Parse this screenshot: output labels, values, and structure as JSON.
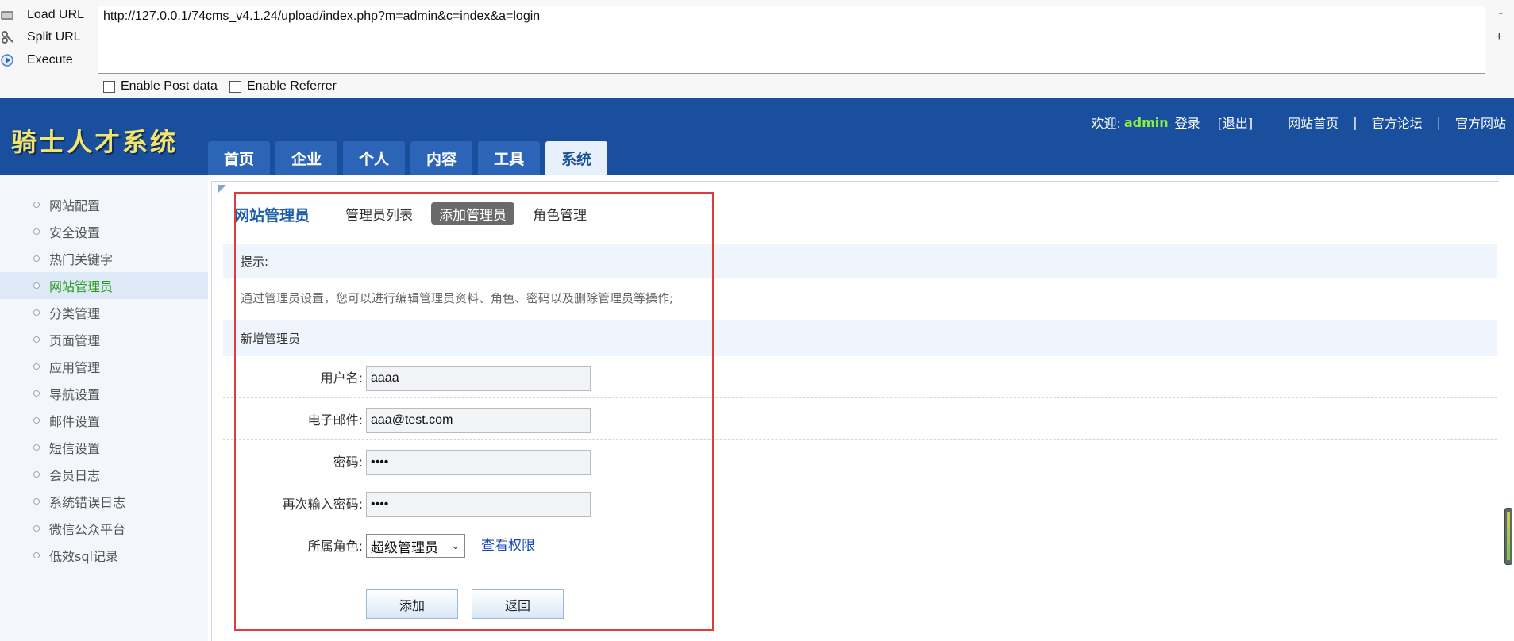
{
  "hackbar": {
    "buttons": [
      {
        "label": "Load URL",
        "icon": "load-url-icon"
      },
      {
        "label": "Split URL",
        "icon": "split-url-icon"
      },
      {
        "label": "Execute",
        "icon": "execute-icon"
      }
    ],
    "url": "http://127.0.0.1/74cms_v4.1.24/upload/index.php?m=admin&c=index&a=login",
    "side_minus": "-",
    "side_plus": "+",
    "enable_post": "Enable Post data",
    "enable_referrer": "Enable Referrer"
  },
  "header": {
    "logo": "骑士人才系统",
    "welcome": "欢迎:",
    "username": "admin",
    "login": "登录",
    "logout": "[退出]",
    "home": "网站首页",
    "sep": "|",
    "forum": "官方论坛",
    "official": "官方网站",
    "tabs": [
      "首页",
      "企业",
      "个人",
      "内容",
      "工具",
      "系统"
    ],
    "active_tab": "系统"
  },
  "sidebar": {
    "items": [
      "网站配置",
      "安全设置",
      "热门关键字",
      "网站管理员",
      "分类管理",
      "页面管理",
      "应用管理",
      "导航设置",
      "邮件设置",
      "短信设置",
      "会员日志",
      "系统错误日志",
      "微信公众平台",
      "低效sql记录"
    ],
    "active": "网站管理员"
  },
  "main": {
    "title": "网站管理员",
    "subtabs": [
      "管理员列表",
      "添加管理员",
      "角色管理"
    ],
    "active_subtab": "添加管理员",
    "hint_label": "提示:",
    "hint_text": "通过管理员设置，您可以进行编辑管理员资料、角色、密码以及删除管理员等操作;",
    "section_title": "新增管理员",
    "form": {
      "username_label": "用户名:",
      "username_value": "aaaa",
      "email_label": "电子邮件:",
      "email_value": "aaa@test.com",
      "password_label": "密码:",
      "password_value": "aaaa",
      "password2_label": "再次输入密码:",
      "password2_value": "aaaa",
      "role_label": "所属角色:",
      "role_value": "超级管理员",
      "perm_link": "查看权限"
    },
    "add_button": "添加",
    "back_button": "返回"
  },
  "colors": {
    "header_bg": "#1a4f9e",
    "logo": "#f2e46d",
    "username": "#8df03b",
    "active_sidebar_text": "#2a9a17",
    "highlight_box": "#e23b3b"
  }
}
